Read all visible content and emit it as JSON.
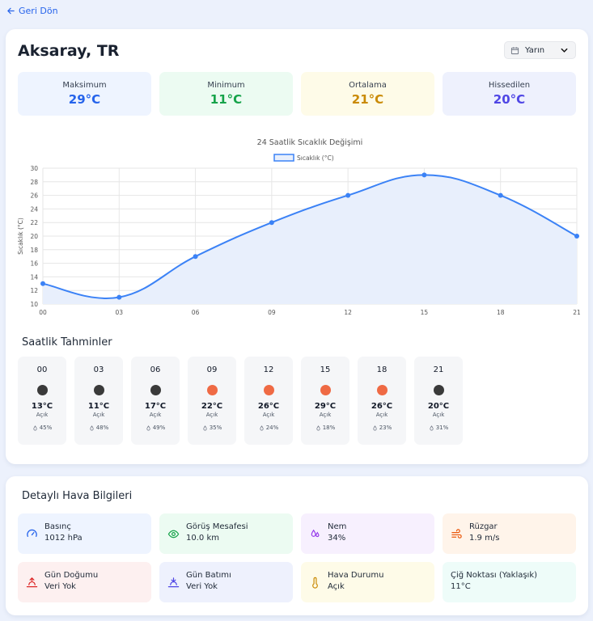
{
  "nav": {
    "back_label": "Geri Dön"
  },
  "header": {
    "city": "Aksaray, TR",
    "day_select": "Yarın"
  },
  "stats": [
    {
      "label": "Maksimum",
      "value": "29°C",
      "bg": "#eef4ff",
      "color": "#2563eb"
    },
    {
      "label": "Minimum",
      "value": "11°C",
      "bg": "#ecfbf2",
      "color": "#16a34a"
    },
    {
      "label": "Ortalama",
      "value": "21°C",
      "bg": "#fefbe8",
      "color": "#ca8a04"
    },
    {
      "label": "Hissedilen",
      "value": "20°C",
      "bg": "#eef1fd",
      "color": "#4f46e5"
    }
  ],
  "chart_data": {
    "type": "area",
    "title": "24 Saatlik Sıcaklık Değişimi",
    "legend": "Sıcaklık (°C)",
    "legend_position": "top-center",
    "ylabel": "Sıcaklık (°C)",
    "xlabel": "",
    "categories": [
      "00",
      "03",
      "06",
      "09",
      "12",
      "15",
      "18",
      "21"
    ],
    "series": [
      {
        "name": "Sıcaklık (°C)",
        "values": [
          13,
          11,
          17,
          22,
          26,
          29,
          26,
          20
        ]
      }
    ],
    "ylim": [
      10,
      30
    ],
    "yticks": [
      10,
      12,
      14,
      16,
      18,
      20,
      22,
      24,
      26,
      28,
      30
    ],
    "grid": true,
    "line_color": "#3b82f6",
    "fill_color": "#e8effc"
  },
  "hourly": {
    "title": "Saatlik Tahminler",
    "items": [
      {
        "hour": "00",
        "temp": "13°C",
        "desc": "Açık",
        "rain": "45%",
        "dot": "#3a3a3a"
      },
      {
        "hour": "03",
        "temp": "11°C",
        "desc": "Açık",
        "rain": "48%",
        "dot": "#3a3a3a"
      },
      {
        "hour": "06",
        "temp": "17°C",
        "desc": "Açık",
        "rain": "49%",
        "dot": "#3a3a3a"
      },
      {
        "hour": "09",
        "temp": "22°C",
        "desc": "Açık",
        "rain": "35%",
        "dot": "#ef6a44"
      },
      {
        "hour": "12",
        "temp": "26°C",
        "desc": "Açık",
        "rain": "24%",
        "dot": "#ef6a44"
      },
      {
        "hour": "15",
        "temp": "29°C",
        "desc": "Açık",
        "rain": "18%",
        "dot": "#ef6a44"
      },
      {
        "hour": "18",
        "temp": "26°C",
        "desc": "Açık",
        "rain": "23%",
        "dot": "#ef6a44"
      },
      {
        "hour": "21",
        "temp": "20°C",
        "desc": "Açık",
        "rain": "31%",
        "dot": "#3a3a3a"
      }
    ]
  },
  "details": {
    "title": "Detaylı Hava Bilgileri",
    "items": [
      {
        "label": "Basınç",
        "value": "1012 hPa",
        "icon": "gauge-icon",
        "bg": "#eef4ff",
        "icolor": "#2563eb"
      },
      {
        "label": "Görüş Mesafesi",
        "value": "10.0 km",
        "icon": "eye-icon",
        "bg": "#ecfbf2",
        "icolor": "#16a34a"
      },
      {
        "label": "Nem",
        "value": "34%",
        "icon": "droplets-icon",
        "bg": "#f7f0fe",
        "icolor": "#9333ea"
      },
      {
        "label": "Rüzgar",
        "value": "1.9 m/s",
        "icon": "wind-icon",
        "bg": "#fff4ea",
        "icolor": "#ea580c"
      },
      {
        "label": "Gün Doğumu",
        "value": "Veri Yok",
        "icon": "sunrise-icon",
        "bg": "#fdf0f0",
        "icolor": "#dc2626"
      },
      {
        "label": "Gün Batımı",
        "value": "Veri Yok",
        "icon": "sunset-icon",
        "bg": "#eef1fd",
        "icolor": "#4f46e5"
      },
      {
        "label": "Hava Durumu",
        "value": "Açık",
        "icon": "thermometer-icon",
        "bg": "#fefbe8",
        "icolor": "#ca8a04"
      },
      {
        "label": "Çiğ Noktası (Yaklaşık)",
        "value": "11°C",
        "icon": "",
        "bg": "#eefcf9",
        "icolor": "#0d9488"
      }
    ]
  }
}
